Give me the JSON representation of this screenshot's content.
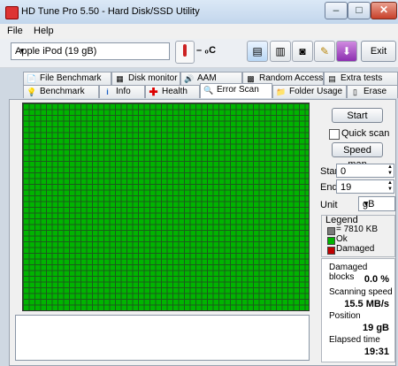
{
  "window": {
    "title": "HD Tune Pro 5.50 - Hard Disk/SSD Utility",
    "min": "–",
    "max": "□",
    "close": "✕"
  },
  "menu": [
    "File",
    "Help"
  ],
  "toolbar": {
    "drive": "Apple   iPod (19 gB)",
    "temperature": "– ₀C",
    "exit_label": "Exit",
    "icons": [
      "copy-info-icon",
      "copy-text-icon",
      "screenshot-icon",
      "options-icon",
      "download-icon"
    ]
  },
  "tabs_top": [
    "File Benchmark",
    "Disk monitor",
    "AAM",
    "Random Access",
    "Extra tests"
  ],
  "tabs_bottom": [
    "Benchmark",
    "Info",
    "Health",
    "Error Scan",
    "Folder Usage",
    "Erase"
  ],
  "active_tab": "Error Scan",
  "controls": {
    "start": "Start",
    "quick_scan": "Quick scan",
    "speed_map": "Speed map",
    "start_label": "Start",
    "start_value": "0",
    "end_label": "End",
    "end_value": "19",
    "unit_label": "Unit",
    "unit_value": "gB"
  },
  "legend": {
    "title": "Legend",
    "block": "= 7810 KB",
    "ok": "Ok",
    "damaged": "Damaged",
    "colors": {
      "block": "#7a7a7a",
      "ok": "#00b400",
      "damaged": "#c00000"
    }
  },
  "stats": {
    "damaged_label": "Damaged blocks",
    "damaged_value": "0.0 %",
    "speed_label": "Scanning speed",
    "speed_value": "15.5 MB/s",
    "position_label": "Position",
    "position_value": "19 gB",
    "elapsed_label": "Elapsed time",
    "elapsed_value": "19:31"
  },
  "scan_grid": {
    "status": "ok",
    "color": "#00b400"
  }
}
